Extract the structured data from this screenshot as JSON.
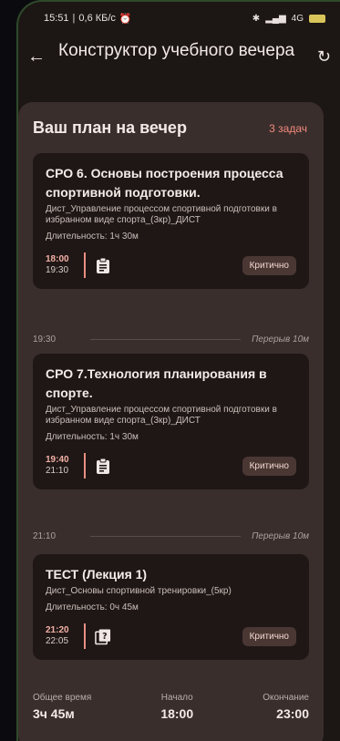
{
  "status_bar": {
    "time": "15:51",
    "speed": "0,6 КБ/с",
    "network": "4G"
  },
  "app_bar": {
    "title": "Конструктор учебного вечера"
  },
  "plan": {
    "title": "Ваш план на вечер",
    "task_count": "3 задач",
    "tasks": [
      {
        "title": "СРО 6. Основы построения процесса спортивной подготовки.",
        "subject": "Дист_Управление процессом спортивной подготовки в избранном виде спорта_(3кр)_ДИСТ",
        "duration": "Длительность: 1ч 30м",
        "start": "18:00",
        "end": "19:30",
        "icon": "clipboard-icon",
        "badge": "Критично"
      },
      {
        "title": "СРО 7.Технология планирования в спорте.",
        "subject": "Дист_Управление процессом спортивной подготовки в избранном виде спорта_(3кр)_ДИСТ",
        "duration": "Длительность: 1ч 30м",
        "start": "19:40",
        "end": "21:10",
        "icon": "clipboard-icon",
        "badge": "Критично"
      },
      {
        "title": "ТЕСТ (Лекция 1)",
        "subject": "Дист_Основы спортивной тренировки_(5кр)",
        "duration": "Длительность: 0ч 45м",
        "start": "21:20",
        "end": "22:05",
        "icon": "quiz-icon",
        "badge": "Критично"
      }
    ],
    "breaks": [
      {
        "time": "19:30",
        "label": "Перерыв 10м"
      },
      {
        "time": "21:10",
        "label": "Перерыв 10м"
      }
    ],
    "summary": {
      "total_label": "Общее время",
      "total_value": "3ч 45м",
      "start_label": "Начало",
      "start_value": "18:00",
      "end_label": "Окончание",
      "end_value": "23:00"
    }
  },
  "colors": {
    "accent": "#f08a7e",
    "card_bg": "#1f1715",
    "panel_bg": "#3a2e2c"
  }
}
